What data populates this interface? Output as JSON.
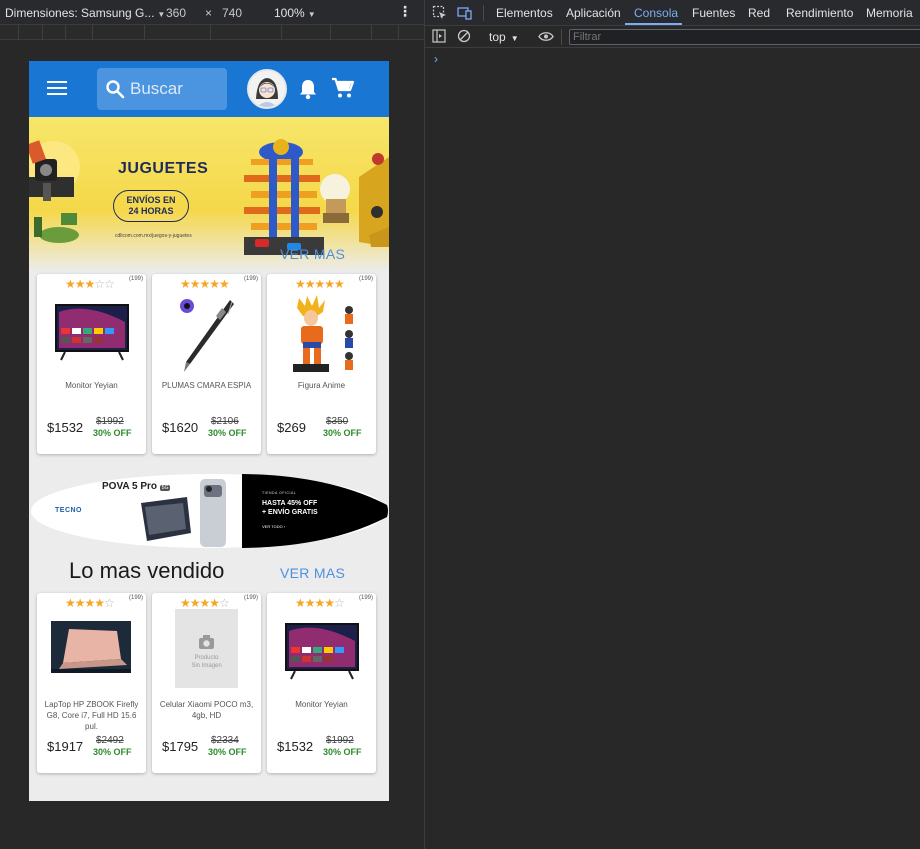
{
  "devtools_device_bar": {
    "dimensions_label": "Dimensiones: Samsung G...",
    "width": "360",
    "times": "×",
    "height": "740",
    "zoom": "100%"
  },
  "devtools": {
    "tabs": [
      "Elementos",
      "Aplicación",
      "Consola",
      "Fuentes",
      "Red",
      "Rendimiento",
      "Memoria"
    ],
    "active_tab": "Consola",
    "context": "top",
    "filter_placeholder": "Filtrar",
    "prompt": "›"
  },
  "app": {
    "search_placeholder": "Buscar",
    "banner": {
      "title": "JUGUETES",
      "pill_line1": "ENVÍOS EN",
      "pill_line2": "24 HORAS",
      "url": "cdlicom.com.mx/juegos-y-juguetes",
      "ver_mas": "VER MAS"
    },
    "featured": [
      {
        "rating": 3,
        "count": "(199)",
        "name": "Monitor Yeyian",
        "price": "$1532",
        "old_price": "$1992",
        "discount": "30% OFF",
        "image": "monitor"
      },
      {
        "rating": 5,
        "count": "(199)",
        "name": "PLUMAS CMARA ESPIA",
        "price": "$1620",
        "old_price": "$2106",
        "discount": "30% OFF",
        "image": "pen"
      },
      {
        "rating": 5,
        "count": "(199)",
        "name": "Figura Anime",
        "price": "$269",
        "old_price": "$350",
        "discount": "30% OFF",
        "image": "figure"
      }
    ],
    "promo": {
      "brand": "TECNO",
      "product": "POVA 5 Pro",
      "badge": "5G",
      "store": "TIENDA OFICIAL",
      "offer_line1": "HASTA 45% OFF",
      "offer_line2": "+ ENVÍO GRATIS",
      "cta": "VER TODO  ›"
    },
    "best_sellers_title": "Lo mas vendido",
    "best_sellers_more": "VER MAS",
    "best_sellers": [
      {
        "rating": 4,
        "count": "(199)",
        "name": "LapTop HP ZBOOK Firefly G8, Core i7, Full HD 15.6 pul.",
        "price": "$1917",
        "old_price": "$2492",
        "discount": "30% OFF",
        "image": "laptop"
      },
      {
        "rating": 4,
        "count": "(199)",
        "name": "Celular Xiaomi POCO m3, 4gb, HD",
        "price": "$1795",
        "old_price": "$2334",
        "discount": "30% OFF",
        "image": "placeholder",
        "placeholder_line1": "Producto",
        "placeholder_line2": "Sin Imagen"
      },
      {
        "rating": 4,
        "count": "(199)",
        "name": "Monitor Yeyian",
        "price": "$1532",
        "old_price": "$1992",
        "discount": "30% OFF",
        "image": "monitor"
      }
    ],
    "colors": {
      "appbar": "#1976d2",
      "link": "#4d8fe0",
      "discount": "#2e8b2e",
      "star": "#f5a623"
    }
  }
}
